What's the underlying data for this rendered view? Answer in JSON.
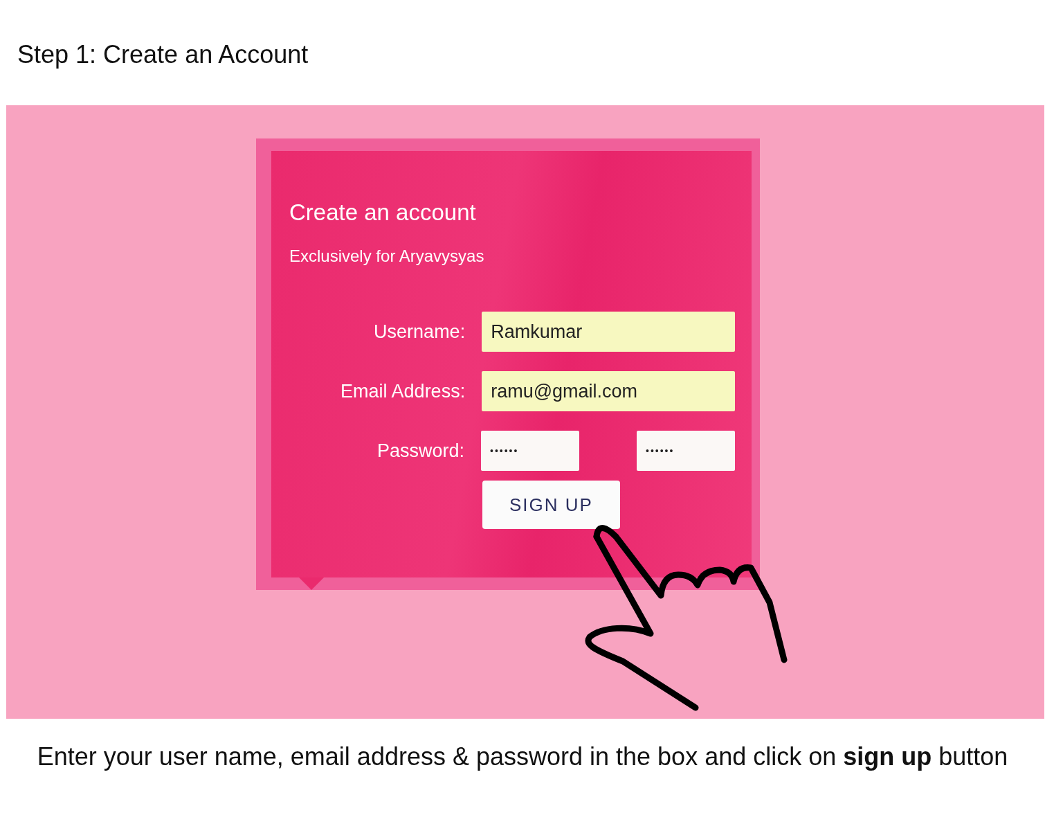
{
  "heading": "Step 1: Create an Account",
  "form": {
    "title": "Create an account",
    "subtitle": "Exclusively for Aryavysyas",
    "fields": [
      {
        "label": "Username:",
        "kind": "text",
        "value": "Ramkumar"
      },
      {
        "label": "Email Address:",
        "kind": "text",
        "value": "ramu@gmail.com"
      },
      {
        "label": "Password:",
        "kind": "password",
        "values": [
          "••••••",
          "••••••"
        ]
      }
    ],
    "button": "SIGN UP"
  },
  "caption": "Enter your user name, email address & password in the box and click on **sign up** button"
}
